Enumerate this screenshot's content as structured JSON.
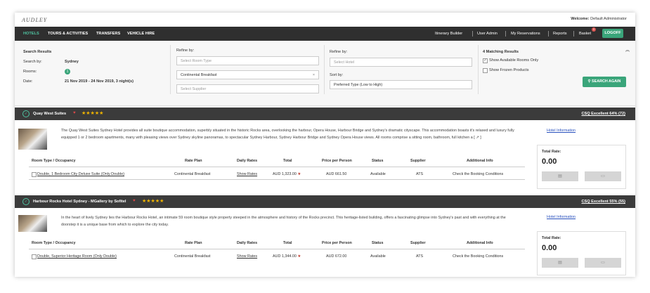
{
  "header": {
    "logo": "AUDLEY",
    "welcome_label": "Welcome:",
    "welcome_user": "Default Administrator"
  },
  "nav": {
    "left": [
      "HOTELS",
      "TOURS & ACTIVITIES",
      "TRANSFERS",
      "VEHICLE HIRE"
    ],
    "right": [
      "Itinerary Builder",
      "User Admin",
      "My Reservations",
      "Reports",
      "Basket"
    ],
    "basket_count": "0",
    "logoff": "LOGOFF"
  },
  "search": {
    "title": "Search Results",
    "search_by_label": "Search by:",
    "search_by_value": "Sydney",
    "rooms_label": "Rooms:",
    "rooms_value": "1",
    "date_label": "Date:",
    "date_value": "21 Nov 2019 - 24 Nov 2019, 3 night(s)",
    "refine1_label": "Refine by:",
    "room_type_placeholder": "Select Room Type",
    "rate_plan_value": "Continental Breakfast",
    "supplier_placeholder": "Select Supplier",
    "refine2_label": "Refine by:",
    "hotel_placeholder": "Select Hotel",
    "sort_label": "Sort by:",
    "sort_value": "Preferred Type (Low to High)",
    "matching": "4 Matching Results",
    "show_available": "Show Available Rooms Only",
    "show_frozen": "Show Frozen Products",
    "search_again": "SEARCH AGAIN"
  },
  "table_headers": [
    "Room Type / Occupancy",
    "Rate Plan",
    "Daily Rates",
    "Total",
    "Price per Person",
    "Status",
    "Supplier",
    "Additional Info"
  ],
  "hotels": [
    {
      "name": "Quay West Suites",
      "stars": "★★★★★",
      "csq": "CSQ Excellent 64% (72)",
      "description": "The Quay West Suites Sydney Hotel provides all suite boutique accommodation, superbly situated in the historic Rocks area, overlooking the harbour, Opera House, Harbour Bridge and Sydney's dramatic cityscape. This accommodation boasts it's relaxed and luxury fully equipped 1 or 2 bedroom apartments, many with pleasing views over Sydney skyline panoramas, to spectacular Sydney Harbour, Sydney Harbour Bridge and Sydney Opera House views. All rooms comprise a sitting room, bathroom, full kitchen a [ ↗ ]",
      "hotel_info": "Hotel Information",
      "room": "Double, 1 Bedroom City Deluxe Suite (Only Double)",
      "rate_plan": "Continental Breakfast",
      "daily": "Show Rates",
      "total": "AUD 1,323.00",
      "ppp": "AUD 661.50",
      "status": "Available",
      "supplier": "ATS",
      "additional": "Check the Booking Conditions",
      "total_label": "Total Rate:",
      "total_rate": "0.00"
    },
    {
      "name": "Harbour Rocks Hotel Sydney - MGallery by Sofitel",
      "stars": "★★★★★",
      "csq": "CSQ Excellent 55% (55)",
      "description": "In the heart of lively Sydney lies the Harbour Rocks Hotel, an intimate 59 room boutique style property steeped in the atmosphere and history of the Rocks precinct. This heritage-listed building, offers a fascinating glimpse into Sydney's past and with everything at the doorstep it is a unique base from which to explore the city today.",
      "hotel_info": "Hotel Information",
      "room": "Double, Superior Heritage Room (Only Double)",
      "rate_plan": "Continental Breakfast",
      "daily": "Show Rates",
      "total": "AUD 1,344.00",
      "ppp": "AUD 672.00",
      "status": "Available",
      "supplier": "ATS",
      "additional": "Check the Booking Conditions",
      "total_label": "Total Rate:",
      "total_rate": "0.00"
    }
  ]
}
